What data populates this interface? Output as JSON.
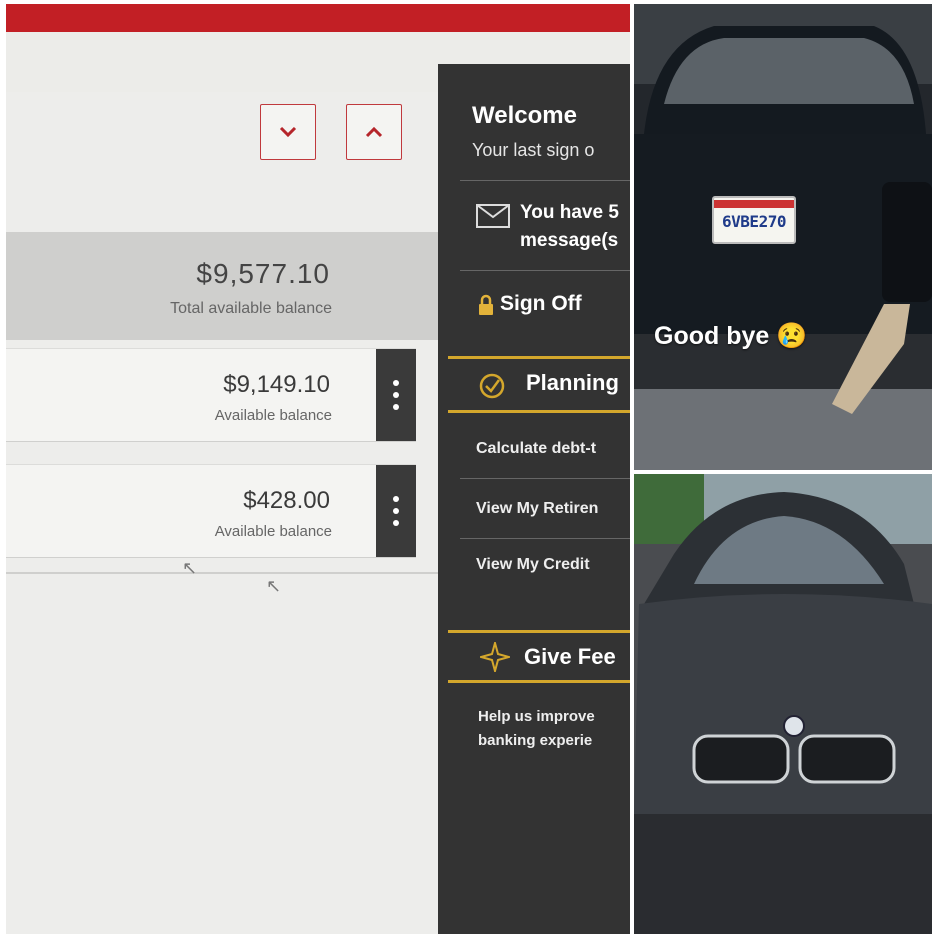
{
  "banking": {
    "summary": {
      "total_amount": "$9,577.10",
      "total_label": "Total available balance"
    },
    "accounts": [
      {
        "amount": "$9,149.10",
        "label": "Available balance"
      },
      {
        "amount": "$428.00",
        "label": "Available balance"
      }
    ],
    "sidebar": {
      "welcome_title": "Welcome",
      "last_sign": "Your last sign o",
      "messages_line1": "You have 5",
      "messages_line2": "message(s",
      "sign_off": "Sign Off",
      "planning_heading": "Planning",
      "planning_items": [
        "Calculate debt-t",
        "View My Retiren",
        "View My Credit"
      ],
      "feedback_heading": "Give Fee",
      "feedback_line1": "Help us improve",
      "feedback_line2": "banking experie"
    },
    "icons": {
      "down": "chevron-down-icon",
      "up": "chevron-up-icon",
      "mail": "envelope-icon",
      "lock": "lock-icon",
      "check": "check-circle-icon",
      "feedback": "compass-star-icon",
      "menu": "kebab-menu-icon"
    },
    "colors": {
      "brand_red": "#c21f25",
      "sidebar_dark": "#333333",
      "gold_accent": "#d4a72c"
    }
  },
  "photos": {
    "top": {
      "caption": "Good bye 😢",
      "license_plate": "6VBE270"
    }
  }
}
